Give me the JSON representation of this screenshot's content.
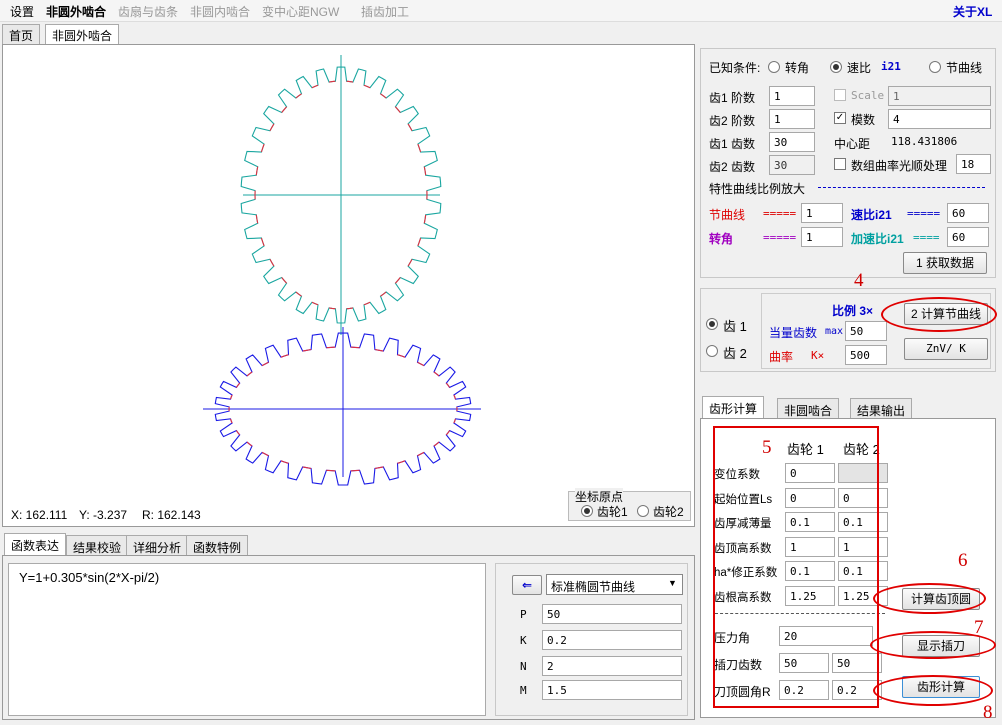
{
  "menu": {
    "settings": "设置",
    "noncircular_outer": "非圆外啮合",
    "sector": "齿扇与齿条",
    "noncircular_inner": "非圆内啮合",
    "variable_center": "变中心距NGW",
    "shaping": "插齿加工",
    "about": "关于XL"
  },
  "top_tabs": [
    "首页",
    "非圆外啮合"
  ],
  "canvas": {
    "coord_x": "X: 162.111",
    "coord_y": "Y: -3.237",
    "coord_r": "R: 162.143",
    "origin_group": "坐标原点",
    "origin_gear1": "齿轮1",
    "origin_gear2": "齿轮2"
  },
  "known": {
    "label": "已知条件:",
    "opt_angle": "转角",
    "opt_ratio": "速比",
    "ratio_tag": "i21",
    "opt_pitch": "节曲线",
    "gear1_order_label": "齿1 阶数",
    "gear1_order": "1",
    "gear2_order_label": "齿2 阶数",
    "gear2_order": "1",
    "gear1_teeth_label": "齿1 齿数",
    "gear1_teeth": "30",
    "gear2_teeth_label": "齿2 齿数",
    "gear2_teeth": "30",
    "scale_label": "Scale",
    "scale_value": "1",
    "module_label": "模数",
    "module_value": "4",
    "center_label": "中心距",
    "center_value": "118.431806",
    "smooth_label": "数组曲率光顺处理",
    "smooth_value": "18",
    "curve_scale_title": "特性曲线比例放大",
    "pitch_curve_label": "节曲线",
    "pitch_curve_value": "1",
    "ratio_label": "速比i21",
    "ratio_value": "60",
    "angle_label": "转角",
    "angle_value": "1",
    "accel_label": "加速比i21",
    "accel_value": "60",
    "get_data_button": "1 获取数据"
  },
  "scale": {
    "gear1": "齿 1",
    "gear2": "齿 2",
    "ratio_title": "比例 3×",
    "equiv_teeth_label": "当量齿数",
    "max_label": "max",
    "equiv_teeth_value": "50",
    "curvature_label": "曲率",
    "k_label": "K×",
    "curvature_value": "500",
    "calc_pitch_button": "2 计算节曲线",
    "znv_button": "ZnV/ K"
  },
  "tooth": {
    "tabs": [
      "齿形计算",
      "非圆啮合",
      "结果输出"
    ],
    "col1": "齿轮 1",
    "col2": "齿轮 2",
    "rows": [
      {
        "label": "变位系数",
        "v1": "0",
        "v2": ""
      },
      {
        "label": "起始位置Ls",
        "v1": "0",
        "v2": "0"
      },
      {
        "label": "齿厚减薄量",
        "v1": "0.1",
        "v2": "0.1"
      },
      {
        "label": "齿顶高系数",
        "v1": "1",
        "v2": "1"
      },
      {
        "label": "ha*修正系数",
        "v1": "0.1",
        "v2": "0.1"
      },
      {
        "label": "齿根高系数",
        "v1": "1.25",
        "v2": "1.25"
      }
    ],
    "pressure_label": "压力角",
    "pressure_value": "20",
    "cutter_teeth_label": "插刀齿数",
    "cutter_teeth_1": "50",
    "cutter_teeth_2": "50",
    "tip_radius_label": "刀顶圆角R",
    "tip_radius_1": "0.2",
    "tip_radius_2": "0.2",
    "calc_tip_button": "计算齿顶圆",
    "show_cutter_button": "显示插刀",
    "calc_tooth_button": "齿形计算"
  },
  "func": {
    "tabs": [
      "函数表达",
      "结果校验",
      "详细分析",
      "函数特例"
    ],
    "expression": "Y=1+0.305*sin(2*X-pi/2)",
    "preset": "标准椭圆节曲线",
    "params": [
      {
        "name": "P",
        "value": "50"
      },
      {
        "name": "K",
        "value": "0.2"
      },
      {
        "name": "N",
        "value": "2"
      },
      {
        "name": "M",
        "value": "1.5"
      }
    ]
  },
  "annotations": [
    "4",
    "5",
    "6",
    "7",
    "8"
  ],
  "colors": {
    "gear1": "#1aa6a0",
    "gear2": "#1a1ae6",
    "tooth_root": "#e03040",
    "annotation": "#e00000",
    "blue_text": "#0000cc",
    "red_text": "#dd0000"
  }
}
